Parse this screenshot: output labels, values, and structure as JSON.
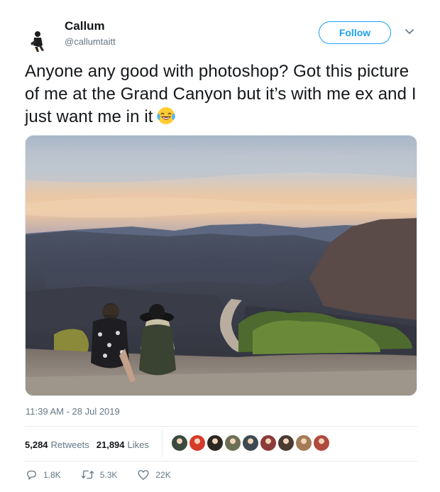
{
  "user": {
    "display_name": "Callum",
    "handle": "@callumtaitt"
  },
  "header": {
    "follow_label": "Follow",
    "avatar_icon": "avatar-icon",
    "menu_icon": "chevron-down-icon"
  },
  "tweet": {
    "text": "Anyone any good with photoshop? Got this picture of me at the Grand Canyon but it’s with me ex and I just want me in it",
    "emoji": "tears-of-joy-emoji",
    "timestamp": "11:39 AM - 28 Jul 2019"
  },
  "stats": {
    "retweets_count": "5,284",
    "retweets_label": "Retweets",
    "likes_count": "21,894",
    "likes_label": "Likes"
  },
  "likers": {
    "colors": [
      "#3a4a3f",
      "#d63a2a",
      "#2c2623",
      "#6b6f55",
      "#3e4a52",
      "#8c3b3b",
      "#4a3a30",
      "#a37b56",
      "#b14a3e"
    ]
  },
  "actions": {
    "reply_count": "1.8K",
    "retweet_count": "5.3K",
    "like_count": "22K"
  },
  "colors": {
    "accent": "#1da1f2",
    "muted": "#657786",
    "text": "#14171a"
  }
}
